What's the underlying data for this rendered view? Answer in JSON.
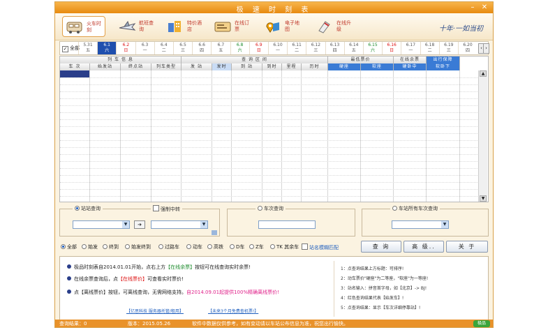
{
  "window": {
    "title": "极 速 时 刻 表"
  },
  "toolbar": {
    "items": [
      {
        "label": "火车时刻",
        "icon": "train-icon",
        "active": true
      },
      {
        "label": "航班查询",
        "icon": "plane-icon"
      },
      {
        "label": "特价酒店",
        "icon": "hotel-icon"
      },
      {
        "label": "在线订票",
        "icon": "ticket-icon"
      },
      {
        "label": "电子地图",
        "icon": "map-icon"
      },
      {
        "label": "在线升级",
        "icon": "update-icon"
      }
    ],
    "brand": "十年·一如当初"
  },
  "datebar": {
    "all_label": "全部",
    "dates": [
      {
        "d": "5.31",
        "w": "五"
      },
      {
        "d": "6.1",
        "w": "六",
        "sel": true
      },
      {
        "d": "6.2",
        "w": "日",
        "color": "red"
      },
      {
        "d": "6.3",
        "w": "一"
      },
      {
        "d": "6.4",
        "w": "二"
      },
      {
        "d": "6.5",
        "w": "三"
      },
      {
        "d": "6.6",
        "w": "四"
      },
      {
        "d": "6.7",
        "w": "五"
      },
      {
        "d": "6.8",
        "w": "六",
        "color": "green"
      },
      {
        "d": "6.9",
        "w": "日",
        "color": "red"
      },
      {
        "d": "6.10",
        "w": "一"
      },
      {
        "d": "6.11",
        "w": "二"
      },
      {
        "d": "6.12",
        "w": "三"
      },
      {
        "d": "6.13",
        "w": "四"
      },
      {
        "d": "6.14",
        "w": "五"
      },
      {
        "d": "6.15",
        "w": "六",
        "color": "green"
      },
      {
        "d": "6.16",
        "w": "日",
        "color": "red"
      },
      {
        "d": "6.17",
        "w": "一"
      },
      {
        "d": "6.18",
        "w": "二"
      },
      {
        "d": "6.19",
        "w": "三"
      },
      {
        "d": "6.20",
        "w": "四"
      }
    ]
  },
  "grid": {
    "groups": [
      {
        "label": "列 车 信 息",
        "span": 4
      },
      {
        "label": "查 询 区 间",
        "span": 6
      },
      {
        "label": "最低票价",
        "span": 2
      },
      {
        "label": "在线余票",
        "span": 1
      },
      {
        "label": "出行保障",
        "span": 1,
        "blue": true
      }
    ],
    "columns": [
      {
        "label": "车 次",
        "w": 43
      },
      {
        "label": "始发站",
        "w": 44
      },
      {
        "label": "终点站",
        "w": 44
      },
      {
        "label": "列车类型",
        "w": 43
      },
      {
        "label": "发 站",
        "w": 44
      },
      {
        "label": "发时",
        "w": 28,
        "sort": true
      },
      {
        "label": "到 站",
        "w": 44
      },
      {
        "label": "到时",
        "w": 28
      },
      {
        "label": "里程",
        "w": 28
      },
      {
        "label": "历时",
        "w": 38
      },
      {
        "label": "硬座",
        "w": 47,
        "blue": true
      },
      {
        "label": "软座",
        "w": 47,
        "blue": true
      },
      {
        "label": "硬卧中",
        "w": 47,
        "blue": true
      },
      {
        "label": "软卧下",
        "w": 48,
        "blue": true
      }
    ]
  },
  "search": {
    "station_label": "站站查询",
    "transfer_label": "强制中转",
    "train_label": "车次查询",
    "all_trains_label": "车站所有车次查询",
    "swap_symbol": "➔"
  },
  "filters": [
    {
      "label": "全部",
      "checked": true
    },
    {
      "label": "始发"
    },
    {
      "label": "终到"
    },
    {
      "label": "始发终到"
    },
    {
      "label": "过路车"
    },
    {
      "label": "动车"
    },
    {
      "label": "高铁"
    },
    {
      "label": "D车"
    },
    {
      "label": "Z车"
    },
    {
      "label": "TK 其余车"
    }
  ],
  "fuzzy_label": "站名模糊匹配",
  "buttons": {
    "query": "查 询",
    "advanced": "高 级..",
    "close": "关 于"
  },
  "notes": {
    "n1a": "极品时刻表自2014.01.01开始，点右上方",
    "n1b": "【在线余票】",
    "n1c": "按钮可在线查询实时余票!",
    "n2a": "在线余票查询后，点",
    "n2b": "【在线票价】",
    "n2c": "可查看实时票价!",
    "n3a": "点【离线票价】按钮，可离线查询，无需网络支持。",
    "n3b": "自2014.09.01起提供100%精确离线票价!",
    "link1": "【亿思科技 服务器托管/租用】",
    "link2": "【未来3个月免费查机票!】",
    "tips": [
      "1：点查询结果上方标题：可排序!",
      "2：动车票价\"硬座\"为二等座，\"软座\"为一等座!",
      "3：站名输入：拼音首字母，如【北京】-> BJ!",
      "4：红色查询结果代表【始发车】!",
      "5：点查询结果：显示【车次详细停靠站】!"
    ]
  },
  "status": {
    "result": "查询结果：0",
    "version": "版本：2015.05.26",
    "notice": "软件中数据仅供参考，如有变动请以车站公布信息为准，祝您出行愉快。",
    "logo": "极品"
  }
}
